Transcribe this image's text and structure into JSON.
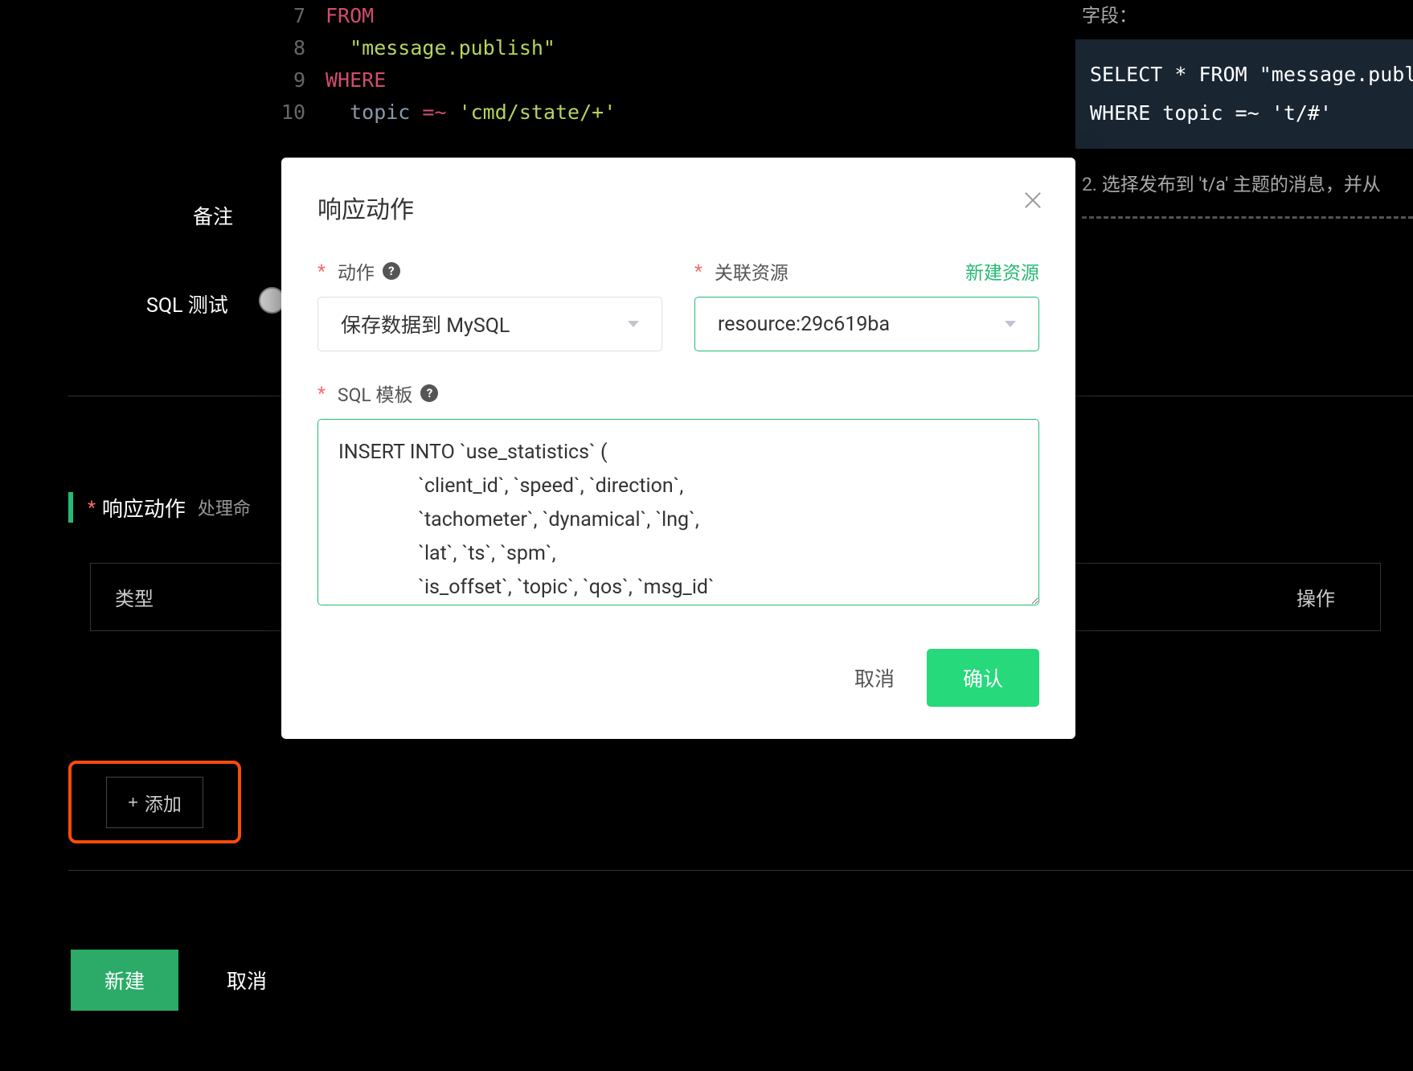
{
  "code": {
    "lines": [
      {
        "num": 7,
        "tokens": [
          {
            "cls": "kw-from",
            "t": "FROM"
          }
        ]
      },
      {
        "num": 8,
        "tokens": [
          {
            "cls": "str-lit",
            "t": "  \"message.publish\""
          }
        ]
      },
      {
        "num": 9,
        "tokens": [
          {
            "cls": "kw-where",
            "t": "WHERE"
          }
        ]
      },
      {
        "num": 10,
        "tokens": [
          {
            "cls": "ident",
            "t": "  topic "
          },
          {
            "cls": "op",
            "t": "=~"
          },
          {
            "cls": "str-lit",
            "t": " 'cmd/state/+'"
          }
        ]
      }
    ]
  },
  "right": {
    "field_label": "字段：",
    "code_line1": "SELECT * FROM \"message.publi",
    "code_line2": "WHERE topic =~ 't/#'",
    "desc": "2. 选择发布到 't/a' 主题的消息，并从"
  },
  "sidebar": {
    "remark_label": "备注",
    "sql_test_label": "SQL 测试"
  },
  "section": {
    "title": "响应动作",
    "subtitle": "处理命"
  },
  "table": {
    "col_type": "类型",
    "col_ops": "操作"
  },
  "add_button_label": "添加",
  "bottom": {
    "create": "新建",
    "cancel": "取消"
  },
  "modal": {
    "title": "响应动作",
    "action_label": "动作",
    "action_value": "保存数据到 MySQL",
    "resource_label": "关联资源",
    "new_resource": "新建资源",
    "resource_value": "resource:29c619ba",
    "sql_template_label": "SQL 模板",
    "sql_template_value": "INSERT INTO `use_statistics` (\n                `client_id`, `speed`, `direction`,\n                `tachometer`, `dynamical`, `lng`,\n                `lat`, `ts`, `spm`,\n                `is_offset`, `topic`, `qos`, `msg_id`",
    "cancel": "取消",
    "confirm": "确认"
  }
}
